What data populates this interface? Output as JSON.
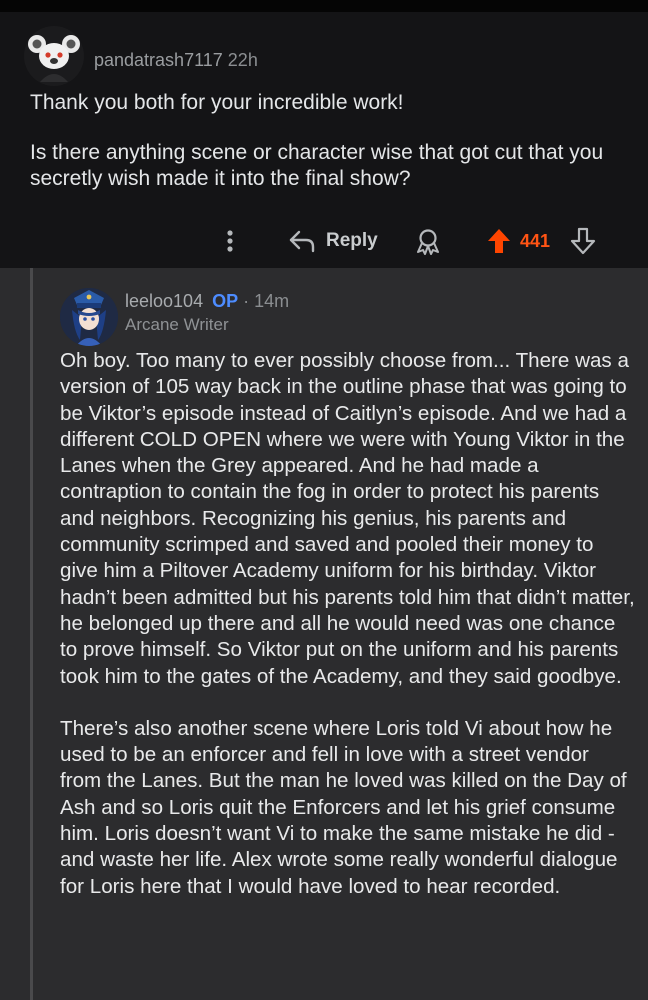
{
  "parent_comment": {
    "username": "pandatrash7117",
    "age": "22h",
    "avatar_icon": "snoo-koala-avatar",
    "paragraphs": [
      "Thank you both for your incredible work!",
      "Is there anything scene or character wise that got cut that you secretly wish made it into the final show?"
    ],
    "actions": {
      "more_icon": "vertical-dots-icon",
      "reply_label": "Reply",
      "award_icon": "award-icon",
      "score": "441",
      "upvote_color": "#ff4500"
    }
  },
  "reply_comment": {
    "username": "leeloo104",
    "op_badge": "OP",
    "separator": "·",
    "age": "14m",
    "flair": "Arcane Writer",
    "avatar_icon": "caitlyn-avatar",
    "paragraphs": [
      "Oh boy. Too many to ever possibly choose from... There was a version of 105 way back in the outline phase that was going to be Viktor’s episode instead of Caitlyn’s episode. And we had a different COLD OPEN where we were with Young Viktor in the Lanes when the Grey appeared. And he had made a contraption to contain the fog in order to protect his parents and neighbors. Recognizing his genius, his parents and community scrimped and saved and pooled their money to give him a Piltover Academy uniform for his birthday. Viktor hadn’t been admitted but his parents told him that didn’t matter, he belonged up there and all he would need was one chance to prove himself. So Viktor put on the uniform and his parents took him to the gates of the Academy, and they said goodbye.",
      "There’s also another scene where Loris told Vi about how he used to be an enforcer and fell in love with a street vendor from the Lanes. But the man he loved was killed on the Day of Ash and so Loris quit the Enforcers and let his grief consume him. Loris doesn’t want Vi to make the same mistake he did - and waste her life. Alex wrote some really wonderful dialogue for Loris here that I would have loved to hear recorded."
    ]
  }
}
